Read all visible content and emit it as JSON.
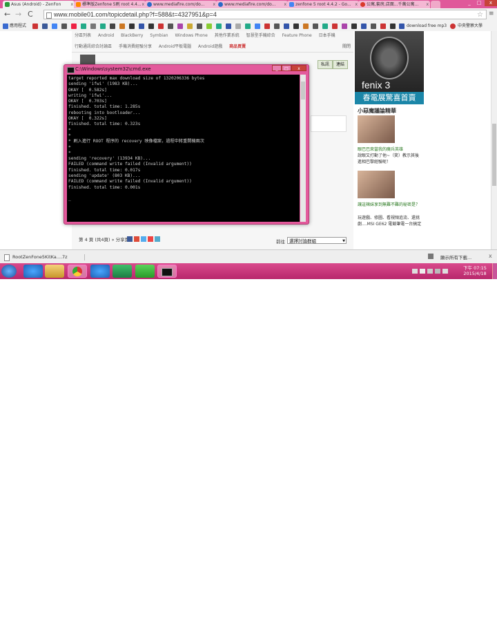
{
  "browser": {
    "tabs": [
      {
        "title": "Asus (Android) - ZenFon",
        "active": true
      },
      {
        "title": "標準版Zenfone 5刷 root 4.4...",
        "active": false
      },
      {
        "title": "www.mediafire.com/do...",
        "active": false
      },
      {
        "title": "www.mediafire.com/do...",
        "active": false
      },
      {
        "title": "zenfone 5 root 4.4.2 - Go...",
        "active": false
      },
      {
        "title": "公寓,套房,店面...千萬公寓...",
        "active": false
      }
    ],
    "close_glyph": "x",
    "url": "www.mobile01.com/topicdetail.php?f=588&t=4327951&p=4",
    "bookmarks_label": "應用程式",
    "bookmark_download": "download free mp3",
    "bookmark_university": "中央警察大學",
    "nav_glyphs": {
      "back": "←",
      "forward": "→",
      "reload": "C",
      "star": "☆",
      "menu": "≡"
    }
  },
  "page": {
    "nav_row1": [
      "分區列表",
      "Android",
      "BlackBerry",
      "Symbian",
      "Windows Phone",
      "其他作業系統",
      "智慧型手機綜合",
      "Feature Phone",
      "日本手機"
    ],
    "nav_row2": [
      "行動通訊綜合討論區",
      "手機消費經驗分享",
      "Android平板電腦",
      "Android遊戲",
      "商品買賣"
    ],
    "nav_close": "關閉",
    "btn_private": "私訊",
    "btn_link": "連結",
    "page_info": "第 4 頁 (共4頁) » 分享到",
    "goto_label": "前往",
    "select_group": "選擇討論群組",
    "sidebar": {
      "ad_brand": "fenix 3",
      "ad_banner": "春電展驚喜首賣",
      "section_title": "小惡魔議論精華",
      "items": [
        {
          "title": "眼巴巴來當我的魔兵英雄",
          "text": "說眼又打動了他~（笑）教示其後進相巴黎經驗呢！"
        },
        {
          "title": "讓這辣妹享到無難不難的秘密是？",
          "text": "玩遊戲、修圖、看視頻追流、還挑劇....MSI GE62 電競筆電一台搞定"
        }
      ]
    }
  },
  "cmd": {
    "title": "C:\\Windows\\system32\\cmd.exe",
    "lines": [
      "target reported max download size of 1320206336 bytes",
      "sending 'ifwi' (1983 KB)...",
      "OKAY [  0.582s]",
      "writing 'ifwi'...",
      "OKAY [  0.703s]",
      "finished. total time: 1.285s",
      "rebooting into bootloader...",
      "OKAY [  0.322s]",
      "finished. total time: 0.323s",
      "*",
      "*",
      "* 刷入進行 ROOT 程序的 recovery 映像檔案，過程中將重開機兩次",
      "*",
      "*",
      "sending 'recovery' (13934 KB)...",
      "FAILED (command write failed (Invalid argument))",
      "finished. total time: 0.017s",
      "sending 'update' (803 KB)...",
      "FAILED (command write failed (Invalid argument))",
      "finished. total time: 0.001s",
      "",
      "_"
    ],
    "buttons": {
      "min": "_",
      "max": "□",
      "close": "x"
    }
  },
  "downloads": {
    "file": "RootZenFone5KitKa....7z",
    "show_all": "顯示所有下載..."
  },
  "taskbar": {
    "time": "下午 07:15",
    "date": "2015/4/18"
  }
}
